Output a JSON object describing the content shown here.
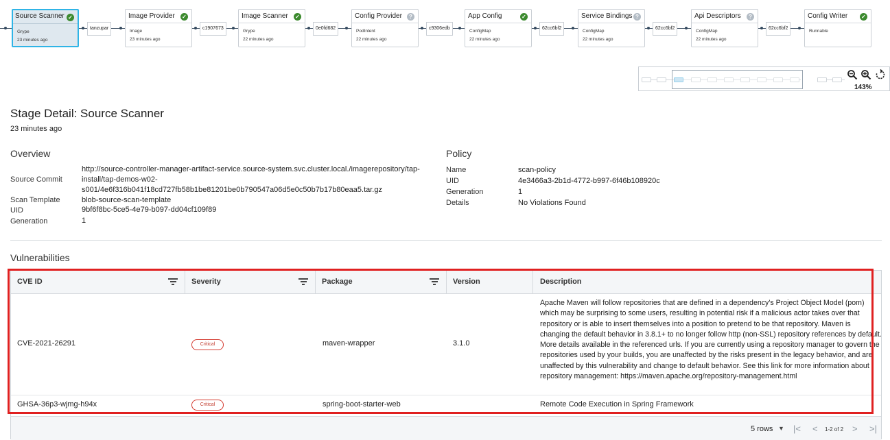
{
  "pipeline": {
    "nodes": [
      {
        "title": "Source Scanner",
        "subtitle": "Grype",
        "time": "23 minutes ago",
        "status": "success"
      },
      {
        "title": "Image Provider",
        "subtitle": "Image",
        "time": "23 minutes ago",
        "status": "success"
      },
      {
        "title": "Image Scanner",
        "subtitle": "Grype",
        "time": "22 minutes ago",
        "status": "success"
      },
      {
        "title": "Config Provider",
        "subtitle": "PodIntent",
        "time": "22 minutes ago",
        "status": "unknown"
      },
      {
        "title": "App Config",
        "subtitle": "ConfigMap",
        "time": "22 minutes ago",
        "status": "success"
      },
      {
        "title": "Service Bindings",
        "subtitle": "ConfigMap",
        "time": "22 minutes ago",
        "status": "unknown"
      },
      {
        "title": "Api Descriptors",
        "subtitle": "ConfigMap",
        "time": "22 minutes ago",
        "status": "unknown"
      },
      {
        "title": "Config Writer",
        "subtitle": "Runnable",
        "time": "",
        "status": "success"
      }
    ],
    "connectors": [
      "tanzupar",
      "c1907673",
      "0e0fd682",
      "c9306edb",
      "62cc6bf2",
      "62cc6bf2",
      "62cc6bf2"
    ],
    "zoom_level": "143%"
  },
  "stage": {
    "title": "Stage Detail: Source Scanner",
    "time": "23 minutes ago"
  },
  "overview": {
    "heading": "Overview",
    "source_commit_label": "Source Commit",
    "source_commit_line1": "http://source-controller-manager-artifact-service.source-system.svc.cluster.local./imagerepository/tap-",
    "source_commit_line2": "install/tap-demos-w02-",
    "source_commit_line3": "s001/4e6f316b041f18cd727fb58b1be81201be0b790547a06d5e0c50b7b17b80eaa5.tar.gz",
    "scan_template_label": "Scan Template",
    "scan_template_value": "blob-source-scan-template",
    "uid_label": "UID",
    "uid_value": "9bf6f8bc-5ce5-4e79-b097-dd04cf109f89",
    "generation_label": "Generation",
    "generation_value": "1"
  },
  "policy": {
    "heading": "Policy",
    "name_label": "Name",
    "name_value": "scan-policy",
    "uid_label": "UID",
    "uid_value": "4e3466a3-2b1d-4772-b997-6f46b108920c",
    "generation_label": "Generation",
    "generation_value": "1",
    "details_label": "Details",
    "details_value": "No Violations Found"
  },
  "vulnerabilities": {
    "heading": "Vulnerabilities",
    "columns": [
      "CVE ID",
      "Severity",
      "Package",
      "Version",
      "Description"
    ],
    "rows": [
      {
        "cve_id": "CVE-2021-26291",
        "severity": "Critical",
        "package": "maven-wrapper",
        "version": "3.1.0",
        "description": "Apache Maven will follow repositories that are defined in a dependency's Project Object Model (pom) which may be surprising to some users, resulting in potential risk if a malicious actor takes over that repository or is able to insert themselves into a position to pretend to be that repository. Maven is changing the default behavior in 3.8.1+ to no longer follow http (non-SSL) repository references by default. More details available in the referenced urls. If you are currently using a repository manager to govern the repositories used by your builds, you are unaffected by the risks present in the legacy behavior, and are unaffected by this vulnerability and change to default behavior. See this link for more information about repository management: https://maven.apache.org/repository-management.html"
      },
      {
        "cve_id": "GHSA-36p3-wjmg-h94x",
        "severity": "Critical",
        "package": "spring-boot-starter-web",
        "version": "",
        "description": "Remote Code Execution in Spring Framework"
      }
    ],
    "footer": {
      "rows_per_page": "5 rows",
      "page_info": "1-2 of 2"
    }
  },
  "colors": {
    "accent": "#2fb4e6",
    "link": "#1a73b5",
    "success": "#3c8a2e",
    "critical": "#d43a2f",
    "highlight": "#e02020"
  }
}
